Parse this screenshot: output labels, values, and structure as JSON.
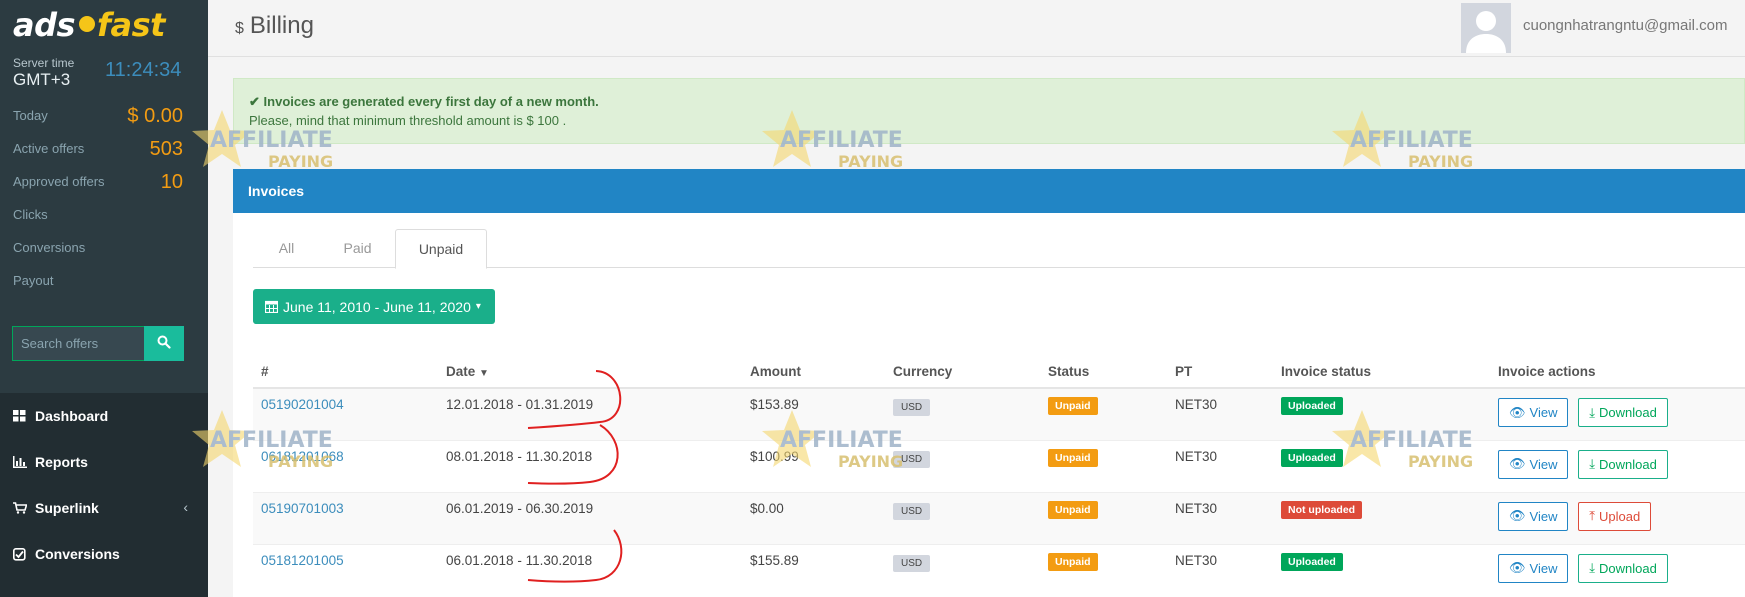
{
  "sidebar": {
    "logo_part1": "ads",
    "logo_part2": "fast",
    "server_time_label": "Server time",
    "timezone": "GMT+3",
    "time": "11:24:34",
    "stats": [
      {
        "label": "Today",
        "value": "$ 0.00"
      },
      {
        "label": "Active offers",
        "value": "503"
      },
      {
        "label": "Approved offers",
        "value": "10"
      },
      {
        "label": "Clicks",
        "value": ""
      },
      {
        "label": "Conversions",
        "value": ""
      },
      {
        "label": "Payout",
        "value": ""
      }
    ],
    "search_placeholder": "Search offers",
    "menu": [
      {
        "label": "Dashboard",
        "icon": "dashboard-icon"
      },
      {
        "label": "Reports",
        "icon": "bar-chart-icon"
      },
      {
        "label": "Superlink",
        "icon": "cart-icon"
      },
      {
        "label": "Conversions",
        "icon": "checkbox-icon"
      }
    ]
  },
  "header": {
    "title": "Billing",
    "title_icon": "$",
    "email": "cuongnhatrangntu@gmail.com"
  },
  "alert": {
    "line1": "Invoices are generated every first day of a new month.",
    "line2": "Please, mind that minimum threshold amount is $ 100 ."
  },
  "box": {
    "title": "Invoices",
    "tabs": [
      "All",
      "Paid",
      "Unpaid"
    ],
    "active_tab": "Unpaid",
    "date_range": "June 11, 2010 - June 11, 2020"
  },
  "table": {
    "headers": [
      "#",
      "Date",
      "Amount",
      "Currency",
      "Status",
      "PT",
      "Invoice status",
      "Invoice actions"
    ],
    "rows": [
      {
        "id": "05190201004",
        "date": "12.01.2018 - 01.31.2019",
        "amount": "$153.89",
        "currency": "USD",
        "status": "Unpaid",
        "pt": "NET30",
        "invoice_status": "Uploaded",
        "view": "View",
        "action": "Download"
      },
      {
        "id": "06181201068",
        "date": "08.01.2018 - 11.30.2018",
        "amount": "$100.99",
        "currency": "USD",
        "status": "Unpaid",
        "pt": "NET30",
        "invoice_status": "Uploaded",
        "view": "View",
        "action": "Download"
      },
      {
        "id": "05190701003",
        "date": "06.01.2019 - 06.30.2019",
        "amount": "$0.00",
        "currency": "USD",
        "status": "Unpaid",
        "pt": "NET30",
        "invoice_status": "Not uploaded",
        "view": "View",
        "action": "Upload"
      },
      {
        "id": "05181201005",
        "date": "06.01.2018 - 11.30.2018",
        "amount": "$155.89",
        "currency": "USD",
        "status": "Unpaid",
        "pt": "NET30",
        "invoice_status": "Uploaded",
        "view": "View",
        "action": "Download"
      }
    ]
  },
  "watermark": {
    "line1": "AFFILIATE",
    "line2": "PAYING"
  },
  "colors": {
    "sidebar": "#2c3b41",
    "primary": "#2185c5",
    "success": "#00a65a",
    "warning": "#f39c12",
    "danger": "#dd4b39"
  }
}
